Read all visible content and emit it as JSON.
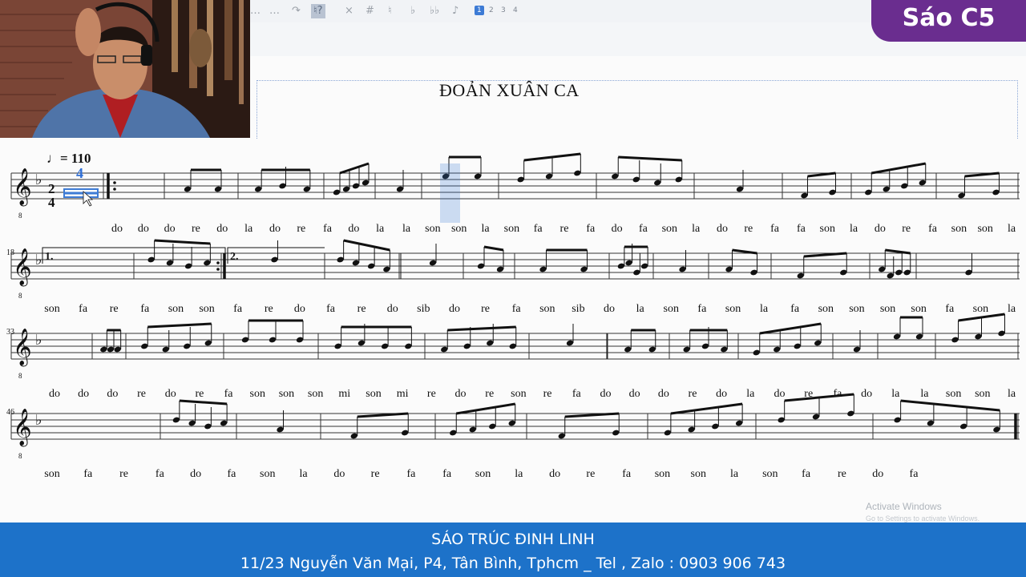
{
  "toolbar": {
    "buttons": [
      "…",
      "…",
      "↷",
      "♮?",
      "×",
      "#",
      "♮",
      "♭",
      "♭♭",
      "♪",
      "1",
      "2",
      "3",
      "4"
    ]
  },
  "badge": {
    "text": "Sáo C5"
  },
  "score": {
    "title": "ĐOẢN XUÂN CA",
    "tempo": "♩= 110",
    "meter_num": "2",
    "meter_den": "4",
    "duration_hint": "4",
    "measure_numbers": [
      "18",
      "33",
      "46"
    ],
    "volta1": "1.",
    "volta2": "2.",
    "lyrics": {
      "line1": [
        "do",
        "do",
        "do",
        "re",
        "do",
        "la",
        "do",
        "re",
        "fa",
        "do",
        "la",
        "la",
        "son",
        "son",
        "la",
        "son",
        "fa",
        "re",
        "fa",
        "do",
        "fa",
        "son",
        "la",
        "do",
        "re",
        "fa",
        "fa",
        "son",
        "la",
        "do",
        "re",
        "fa",
        "son",
        "son",
        "la"
      ],
      "line2": [
        "son",
        "fa",
        "re",
        "fa",
        "son",
        "son",
        "fa",
        "re",
        "do",
        "fa",
        "re",
        "do",
        "sib",
        "do",
        "re",
        "fa",
        "son",
        "sib",
        "do",
        "la",
        "son",
        "fa",
        "son",
        "la",
        "fa",
        "son",
        "son",
        "son",
        "son",
        "fa",
        "son",
        "la"
      ],
      "line3": [
        "do",
        "do",
        "do",
        "re",
        "do",
        "re",
        "fa",
        "son",
        "son",
        "son",
        "mi",
        "son",
        "mi",
        "re",
        "do",
        "re",
        "son",
        "re",
        "fa",
        "do",
        "do",
        "do",
        "re",
        "do",
        "la",
        "do",
        "re",
        "fa",
        "do",
        "la",
        "la",
        "son",
        "son",
        "la"
      ],
      "line4": [
        "son",
        "fa",
        "re",
        "fa",
        "do",
        "fa",
        "son",
        "la",
        "do",
        "re",
        "fa",
        "fa",
        "son",
        "la",
        "do",
        "re",
        "fa",
        "son",
        "son",
        "la",
        "son",
        "fa",
        "re",
        "do",
        "fa"
      ]
    }
  },
  "footer": {
    "line1": "SÁO TRÚC ĐINH LINH",
    "line2": "11/23 Nguyễn Văn Mại, P4, Tân Bình, Tphcm _ Tel , Zalo : 0903 906 743"
  },
  "watermark": {
    "line1": "Activate Windows",
    "line2": "Go to Settings to activate Windows."
  },
  "colors": {
    "badge": "#6a2d8f",
    "footer": "#1d72c9",
    "selection": "#3d7bd5"
  }
}
